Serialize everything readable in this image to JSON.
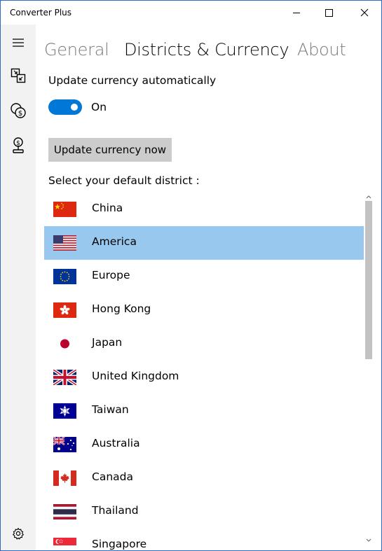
{
  "window": {
    "title": "Converter Plus"
  },
  "sidebar": {
    "items": [
      {
        "icon": "hamburger-menu-icon"
      },
      {
        "icon": "unit-converter-icon"
      },
      {
        "icon": "currency-exchange-icon"
      },
      {
        "icon": "money-stand-icon"
      },
      {
        "icon": "settings-gear-icon"
      }
    ]
  },
  "pivot": {
    "tabs": [
      {
        "label": "General",
        "active": false
      },
      {
        "label": "Districts & Currency",
        "active": true
      },
      {
        "label": "About",
        "active": false
      }
    ]
  },
  "settings": {
    "auto_update_label": "Update currency automatically",
    "toggle_state": "On",
    "update_button": "Update currency now",
    "district_label": "Select your default district :"
  },
  "districts": {
    "selected": "America",
    "items": [
      {
        "name": "China",
        "flag": "china-flag"
      },
      {
        "name": "America",
        "flag": "usa-flag"
      },
      {
        "name": "Europe",
        "flag": "eu-flag"
      },
      {
        "name": "Hong Kong",
        "flag": "hong-kong-flag"
      },
      {
        "name": "Japan",
        "flag": "japan-flag"
      },
      {
        "name": "United Kingdom",
        "flag": "uk-flag"
      },
      {
        "name": "Taiwan",
        "flag": "taiwan-flag"
      },
      {
        "name": "Australia",
        "flag": "australia-flag"
      },
      {
        "name": "Canada",
        "flag": "canada-flag"
      },
      {
        "name": "Thailand",
        "flag": "thailand-flag"
      },
      {
        "name": "Singapore",
        "flag": "singapore-flag"
      }
    ]
  },
  "colors": {
    "accent": "#0078d7",
    "selected_row": "#99c8ee",
    "sidebar_bg": "#f2f2f2",
    "button_bg": "#cccccc"
  }
}
